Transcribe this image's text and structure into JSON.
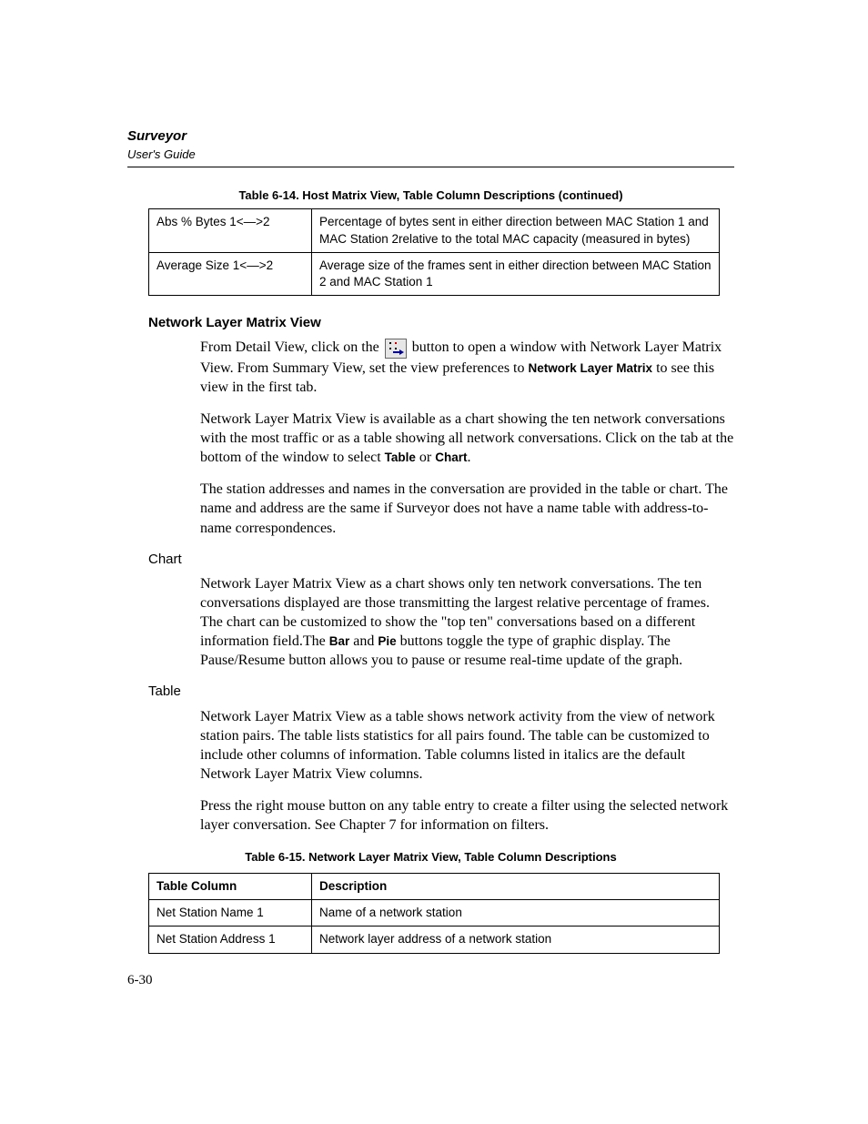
{
  "header": {
    "title": "Surveyor",
    "subtitle": "User's Guide"
  },
  "table614": {
    "caption": "Table 6-14. Host Matrix View, Table Column Descriptions (continued)",
    "rows": [
      {
        "c1": "Abs % Bytes 1<—>2",
        "c2": "Percentage of bytes sent in either direction between MAC Station 1 and MAC Station 2relative to the total MAC capacity (measured in bytes)"
      },
      {
        "c1": "Average Size 1<—>2",
        "c2": "Average size of the frames sent in either direction between MAC Station 2 and MAC Station 1"
      }
    ]
  },
  "section": {
    "heading": "Network Layer Matrix View",
    "p1a": "From Detail View, click on the ",
    "p1b": " button to open a window with Network Layer Matrix View. From Summary View, set the view preferences to ",
    "p1_bold1": "Network Layer Matrix",
    "p1c": " to see this view in the first tab.",
    "p2a": "Network Layer Matrix View is available as a chart showing the ten network conversations with the most traffic or as a table showing all network conversations. Click on the tab at the bottom of the window to select ",
    "p2_bold1": "Table",
    "p2b": " or ",
    "p2_bold2": "Chart",
    "p2c": ".",
    "p3": "The station addresses and names in the conversation are provided in the table or chart. The name and address are the same if Surveyor does not have a name table with address-to-name correspondences.",
    "chart_h": "Chart",
    "chart_p_a": "Network Layer Matrix View as a chart shows only ten network conversations. The ten conversations displayed are those transmitting the largest relative percentage of frames. The chart can be customized to show the \"top ten\" conversations based on a different information field.The ",
    "chart_bold1": "Bar",
    "chart_p_b": " and ",
    "chart_bold2": "Pie",
    "chart_p_c": " buttons toggle the type of graphic display. The Pause/Resume button allows you to pause or resume real-time update of the graph.",
    "table_h": "Table",
    "table_p1": "Network Layer Matrix View as a table shows network activity from the view of network station pairs. The table lists statistics for all pairs found. The table can be customized to include other columns of information. Table columns listed in italics are the default Network Layer Matrix View columns.",
    "table_p2": "Press the right mouse button on any table entry to create a filter using the selected network layer conversation. See Chapter 7 for information on filters."
  },
  "table615": {
    "caption": "Table 6-15. Network Layer Matrix View, Table Column Descriptions",
    "header": {
      "c1": "Table Column",
      "c2": "Description"
    },
    "rows": [
      {
        "c1": "Net Station Name 1",
        "c2": "Name of a network station"
      },
      {
        "c1": "Net Station Address 1",
        "c2": "Network layer address of a network station"
      }
    ]
  },
  "pagenum": "6-30"
}
